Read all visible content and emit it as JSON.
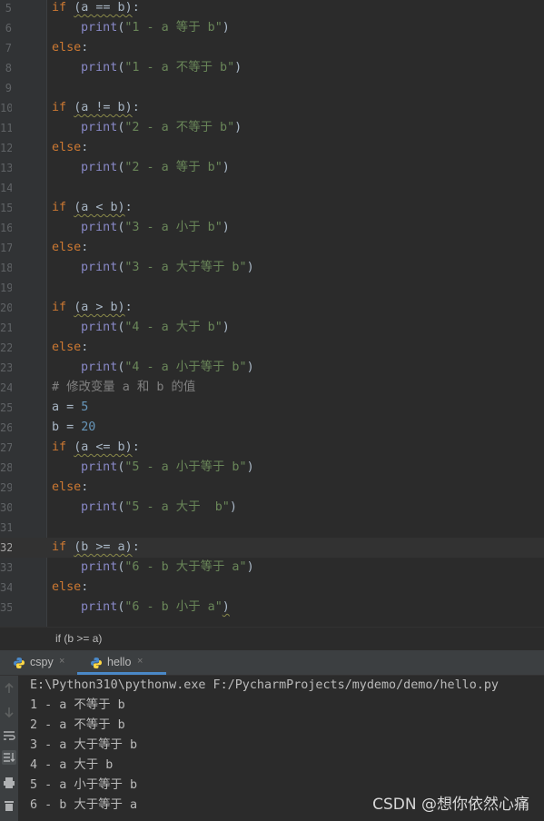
{
  "editor": {
    "lines": [
      {
        "n": "5",
        "parts": [
          [
            "kw",
            "if "
          ],
          [
            "wavy",
            "(a == b)"
          ],
          [
            "txt",
            ":"
          ]
        ]
      },
      {
        "n": "6",
        "indent": 1,
        "parts": [
          [
            "fn",
            "print"
          ],
          [
            "txt",
            "("
          ],
          [
            "str",
            "\"1 - a 等于 b\""
          ],
          [
            "txt",
            ")"
          ]
        ]
      },
      {
        "n": "7",
        "parts": [
          [
            "kw",
            "else"
          ],
          [
            "txt",
            ":"
          ]
        ]
      },
      {
        "n": "8",
        "indent": 1,
        "parts": [
          [
            "fn",
            "print"
          ],
          [
            "txt",
            "("
          ],
          [
            "str",
            "\"1 - a 不等于 b\""
          ],
          [
            "txt",
            ")"
          ]
        ]
      },
      {
        "n": "9",
        "parts": []
      },
      {
        "n": "10",
        "parts": [
          [
            "kw",
            "if "
          ],
          [
            "wavy",
            "(a != b)"
          ],
          [
            "txt",
            ":"
          ]
        ]
      },
      {
        "n": "11",
        "indent": 1,
        "parts": [
          [
            "fn",
            "print"
          ],
          [
            "txt",
            "("
          ],
          [
            "str",
            "\"2 - a 不等于 b\""
          ],
          [
            "txt",
            ")"
          ]
        ]
      },
      {
        "n": "12",
        "parts": [
          [
            "kw",
            "else"
          ],
          [
            "txt",
            ":"
          ]
        ]
      },
      {
        "n": "13",
        "indent": 1,
        "parts": [
          [
            "fn",
            "print"
          ],
          [
            "txt",
            "("
          ],
          [
            "str",
            "\"2 - a 等于 b\""
          ],
          [
            "txt",
            ")"
          ]
        ]
      },
      {
        "n": "14",
        "parts": []
      },
      {
        "n": "15",
        "parts": [
          [
            "kw",
            "if "
          ],
          [
            "wavy",
            "(a < b)"
          ],
          [
            "txt",
            ":"
          ]
        ]
      },
      {
        "n": "16",
        "indent": 1,
        "parts": [
          [
            "fn",
            "print"
          ],
          [
            "txt",
            "("
          ],
          [
            "str",
            "\"3 - a 小于 b\""
          ],
          [
            "txt",
            ")"
          ]
        ]
      },
      {
        "n": "17",
        "parts": [
          [
            "kw",
            "else"
          ],
          [
            "txt",
            ":"
          ]
        ]
      },
      {
        "n": "18",
        "indent": 1,
        "parts": [
          [
            "fn",
            "print"
          ],
          [
            "txt",
            "("
          ],
          [
            "str",
            "\"3 - a 大于等于 b\""
          ],
          [
            "txt",
            ")"
          ]
        ]
      },
      {
        "n": "19",
        "parts": []
      },
      {
        "n": "20",
        "parts": [
          [
            "kw",
            "if "
          ],
          [
            "wavy",
            "(a > b)"
          ],
          [
            "txt",
            ":"
          ]
        ]
      },
      {
        "n": "21",
        "indent": 1,
        "parts": [
          [
            "fn",
            "print"
          ],
          [
            "txt",
            "("
          ],
          [
            "str",
            "\"4 - a 大于 b\""
          ],
          [
            "txt",
            ")"
          ]
        ]
      },
      {
        "n": "22",
        "parts": [
          [
            "kw",
            "else"
          ],
          [
            "txt",
            ":"
          ]
        ]
      },
      {
        "n": "23",
        "indent": 1,
        "parts": [
          [
            "fn",
            "print"
          ],
          [
            "txt",
            "("
          ],
          [
            "str",
            "\"4 - a 小于等于 b\""
          ],
          [
            "txt",
            ")"
          ]
        ]
      },
      {
        "n": "24",
        "parts": [
          [
            "cmt",
            "# 修改变量 a 和 b 的值"
          ]
        ]
      },
      {
        "n": "25",
        "parts": [
          [
            "txt",
            "a = "
          ],
          [
            "num",
            "5"
          ]
        ]
      },
      {
        "n": "26",
        "parts": [
          [
            "txt",
            "b = "
          ],
          [
            "num",
            "20"
          ]
        ]
      },
      {
        "n": "27",
        "parts": [
          [
            "kw",
            "if "
          ],
          [
            "wavy",
            "(a <= b)"
          ],
          [
            "txt",
            ":"
          ]
        ]
      },
      {
        "n": "28",
        "indent": 1,
        "parts": [
          [
            "fn",
            "print"
          ],
          [
            "txt",
            "("
          ],
          [
            "str",
            "\"5 - a 小于等于 b\""
          ],
          [
            "txt",
            ")"
          ]
        ]
      },
      {
        "n": "29",
        "parts": [
          [
            "kw",
            "else"
          ],
          [
            "txt",
            ":"
          ]
        ]
      },
      {
        "n": "30",
        "indent": 1,
        "parts": [
          [
            "fn",
            "print"
          ],
          [
            "txt",
            "("
          ],
          [
            "str",
            "\"5 - a 大于  b\""
          ],
          [
            "txt",
            ")"
          ]
        ]
      },
      {
        "n": "31",
        "parts": []
      },
      {
        "n": "32",
        "current": true,
        "parts": [
          [
            "kw",
            "if "
          ],
          [
            "wavy",
            "(b >= a)"
          ],
          [
            "txt",
            ":"
          ]
        ]
      },
      {
        "n": "33",
        "indent": 1,
        "parts": [
          [
            "fn",
            "print"
          ],
          [
            "txt",
            "("
          ],
          [
            "str",
            "\"6 - b 大于等于 a\""
          ],
          [
            "txt",
            ")"
          ]
        ]
      },
      {
        "n": "34",
        "parts": [
          [
            "kw",
            "else"
          ],
          [
            "txt",
            ":"
          ]
        ]
      },
      {
        "n": "35",
        "indent": 1,
        "parts": [
          [
            "fn",
            "print"
          ],
          [
            "txt",
            "("
          ],
          [
            "str",
            "\"6 - b 小于 a\""
          ],
          [
            "wavy",
            ")"
          ]
        ]
      }
    ]
  },
  "breadcrumb": "if (b >= a)",
  "run_tabs": [
    {
      "label": "cspy",
      "icon": "python-icon",
      "active": false,
      "close": "×"
    },
    {
      "label": "hello",
      "icon": "python-icon",
      "active": true,
      "close": "×"
    }
  ],
  "console": {
    "lines": [
      "E:\\Python310\\pythonw.exe F:/PycharmProjects/mydemo/demo/hello.py",
      "1 - a 不等于 b",
      "2 - a 不等于 b",
      "3 - a 大于等于 b",
      "4 - a 大于 b",
      "5 - a 小于等于 b",
      "6 - b 大于等于 a"
    ],
    "tools": [
      "arrow-up-icon",
      "arrow-down-icon",
      "soft-wrap-icon",
      "scroll-to-end-icon",
      "print-icon",
      "trash-icon"
    ]
  },
  "watermark": "CSDN @想你依然心痛",
  "colors": {
    "background": "#2b2b2b",
    "keyword": "#cc7832",
    "function": "#8888c6",
    "string": "#6a8759",
    "number": "#6897bb",
    "comment": "#808080",
    "accent": "#4a88c7"
  }
}
